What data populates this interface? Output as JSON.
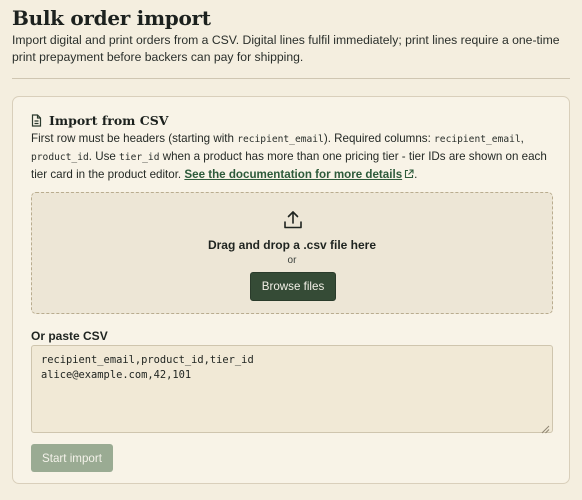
{
  "header": {
    "title": "Bulk order import",
    "subtitle": "Import digital and print orders from a CSV. Digital lines fulfil immediately; print lines require a one-time print prepayment before backers can pay for shipping."
  },
  "import_card": {
    "title": "Import from CSV",
    "icon": "file-text-icon",
    "desc_1": "First row must be headers (starting with ",
    "code_1": "recipient_email",
    "desc_2": "). Required columns: ",
    "code_2": "recipient_email",
    "desc_3": ", ",
    "code_3": "product_id",
    "desc_4": ". Use ",
    "code_4": "tier_id",
    "desc_5": " when a product has more than one pricing tier - tier IDs are shown on each tier card in the product editor. ",
    "doc_link": "See the documentation for more details",
    "desc_6": ".",
    "dropzone": {
      "icon": "upload-icon",
      "text": "Drag and drop a .csv file here",
      "or": "or",
      "browse_label": "Browse files"
    },
    "paste_label": "Or paste CSV",
    "csv_value": "recipient_email,product_id,tier_id\nalice@example.com,42,101",
    "start_label": "Start import"
  },
  "colors": {
    "background": "#f4eedf",
    "primary_button": "#354b36",
    "disabled_button": "#9aab93",
    "link": "#2d5a3a"
  }
}
